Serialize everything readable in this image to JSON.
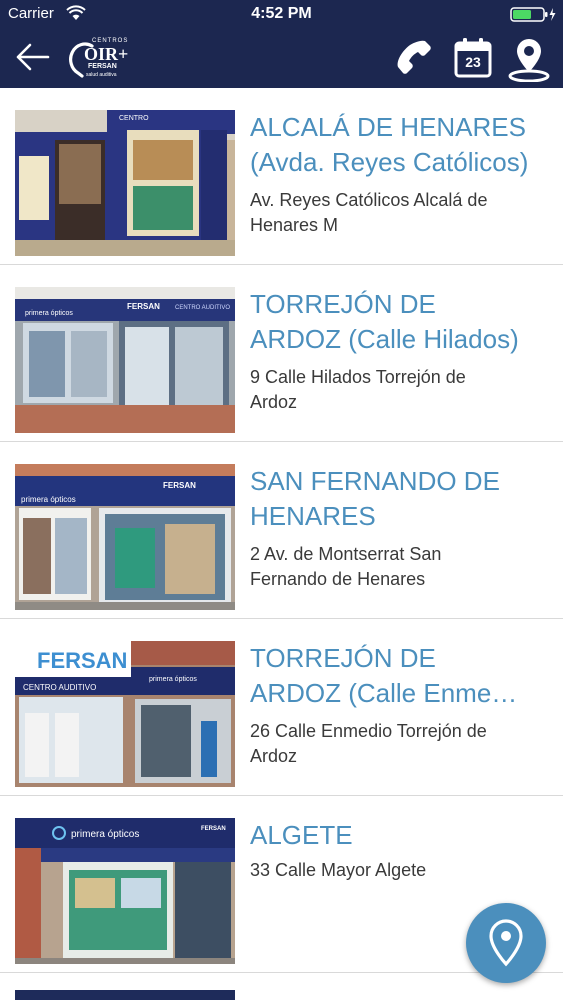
{
  "status_bar": {
    "carrier": "Carrier",
    "time": "4:52 PM",
    "wifi_icon": "wifi-icon",
    "battery_icon": "battery-charging-icon"
  },
  "nav": {
    "back_icon": "arrow-left-icon",
    "logo": {
      "top_text": "CENTROS",
      "main_text": "OIR+",
      "sub_text": "FERSAN",
      "tag_text": "salud auditiva"
    },
    "phone_icon": "phone-icon",
    "calendar_icon": "calendar-icon",
    "calendar_day": "23",
    "location_icon": "map-pin-icon"
  },
  "colors": {
    "header_bg": "#1c2750",
    "title_blue": "#4b8fbd",
    "address_text": "#3a3a3a",
    "divider": "#d9d9d9",
    "fab_bg": "#4b8fbd"
  },
  "stores": [
    {
      "title_line1": "ALCALÁ DE HENARES",
      "title_line2": "(Avda. Reyes Católicos)",
      "address_line1": "Av. Reyes Católicos Alcalá de",
      "address_line2": "Henares M"
    },
    {
      "title_line1": "TORREJÓN DE",
      "title_line2": "ARDOZ (Calle Hilados)",
      "address_line1": "9 Calle Hilados Torrejón de",
      "address_line2": "Ardoz"
    },
    {
      "title_line1": "SAN FERNANDO DE",
      "title_line2": "HENARES",
      "address_line1": "2 Av. de Montserrat San",
      "address_line2": "Fernando de Henares"
    },
    {
      "title_line1": "TORREJÓN DE",
      "title_line2": "ARDOZ (Calle Enme…",
      "address_line1": "26 Calle Enmedio Torrejón de",
      "address_line2": "Ardoz"
    },
    {
      "title_line1": "ALGETE",
      "address_line1": "33 Calle Mayor Algete"
    }
  ],
  "photo_signs": {
    "store1": "CENTRO",
    "store2_brand": "FERSAN",
    "store2_label": "CENTRO AUDITIVO",
    "store2_optics": "primera ópticos",
    "store3_brand": "FERSAN",
    "store3_optics": "primera ópticos",
    "store4_brand": "FERSAN",
    "store4_label": "CENTRO AUDITIVO",
    "store4_optics": "primera ópticos",
    "store5_brand": "FERSAN",
    "store5_optics": "primera ópticos"
  },
  "fab": {
    "icon": "map-pin-icon"
  }
}
